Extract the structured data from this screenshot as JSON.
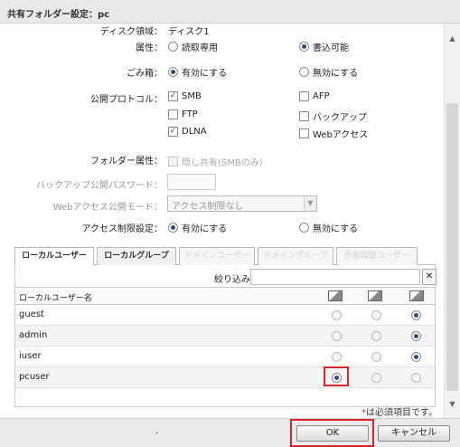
{
  "window": {
    "title": "共有フォルダー設定：pc"
  },
  "form": {
    "disk_label": "ディスク領域：",
    "disk_value": "ディスク1",
    "attr_label": "属性：",
    "attr_options": [
      "読取専用",
      "書込可能"
    ],
    "trash_label": "ごみ箱：",
    "trash_options": [
      "有効にする",
      "無効にする"
    ],
    "protocol_label": "公開プロトコル：",
    "protocols": [
      "SMB",
      "AFP",
      "FTP",
      "バックアップ",
      "DLNA",
      "Webアクセス"
    ],
    "folder_attr_label": "フォルダー属性：",
    "hidden_share": "隠し共有(SMBのみ)",
    "backup_pw_label": "バックアップ公開パスワード：",
    "web_mode_label": "Webアクセス公開モード：",
    "web_mode_value": "アクセス制限なし",
    "access_label": "アクセス制限設定：",
    "access_options": [
      "有効にする",
      "無効にする"
    ]
  },
  "tabs": [
    "ローカルユーザー",
    "ローカルグループ",
    "ドメインユーザー",
    "ドメイングループ",
    "外部認証ユーザー"
  ],
  "filter": {
    "label": "絞り込み：",
    "placeholder": ""
  },
  "table": {
    "header": "ローカルユーザー名",
    "rows": [
      {
        "name": "guest",
        "perm": "none"
      },
      {
        "name": "admin",
        "perm": "none"
      },
      {
        "name": "iuser",
        "perm": "none"
      },
      {
        "name": "pcuser",
        "perm": "rw"
      }
    ]
  },
  "footer": {
    "required_note": "は必須項目です。",
    "required_mark": "*",
    "dot": ".",
    "ok_label": "OK",
    "cancel_label": "キャンセル"
  },
  "colors": {
    "highlight": "#d9262c",
    "radio_selected": "#2a4f8c"
  }
}
